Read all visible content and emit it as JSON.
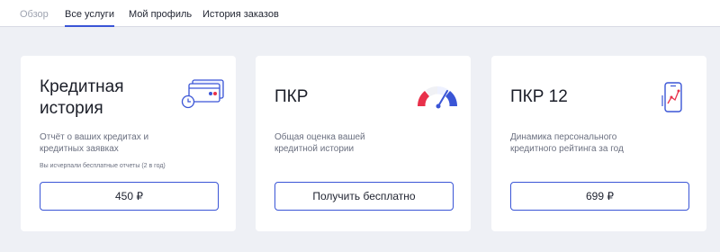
{
  "tabs": [
    {
      "label": "Обзор"
    },
    {
      "label": "Все услуги"
    },
    {
      "label": "Мой профиль"
    },
    {
      "label": "История заказов"
    }
  ],
  "cards": [
    {
      "title_line1": "Кредитная",
      "title_line2": "история",
      "description_line1": "Отчёт о ваших кредитах и",
      "description_line2": "кредитных заявках",
      "note": "Вы исчерпали бесплатные отчеты (2 в год)",
      "button_label": "450 ₽",
      "icon": "credit-card-clock-icon"
    },
    {
      "title_line1": "ПКР",
      "description_line1": "Общая оценка вашей",
      "description_line2": "кредитной истории",
      "button_label": "Получить бесплатно",
      "icon": "rating-gauge-icon"
    },
    {
      "title_line1": "ПКР 12",
      "description_line1": "Динамика персонального",
      "description_line2": "кредитного рейтинга за год",
      "button_label": "699 ₽",
      "icon": "phone-chart-icon"
    }
  ],
  "colors": {
    "accent": "#3a55d6",
    "page_background": "#eef0f5",
    "gauge_red": "#e8304a",
    "gauge_blue": "#3a55d6"
  }
}
